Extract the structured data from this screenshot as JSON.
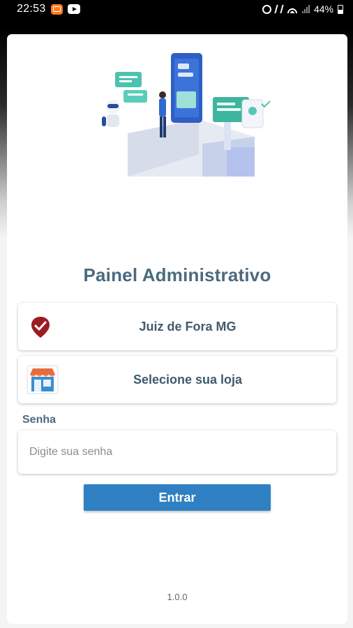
{
  "status_bar": {
    "time": "22:53",
    "battery": "44%",
    "icons": [
      "notification-app-icon",
      "youtube-icon",
      "alarm-icon",
      "mute-icon",
      "wifi-icon",
      "signal-icon",
      "battery-icon"
    ]
  },
  "login": {
    "title": "Painel Administrativo",
    "city": {
      "label": "Juiz de Fora MG",
      "icon": "map-pin-check-icon"
    },
    "store": {
      "label": "Selecione sua loja",
      "icon": "store-icon"
    },
    "password": {
      "label": "Senha",
      "placeholder": "Digite sua senha",
      "value": ""
    },
    "submit_label": "Entrar",
    "version": "1.0.0"
  },
  "colors": {
    "title": "#4b6a80",
    "button": "#2f80c2",
    "pin": "#9c1c22"
  }
}
